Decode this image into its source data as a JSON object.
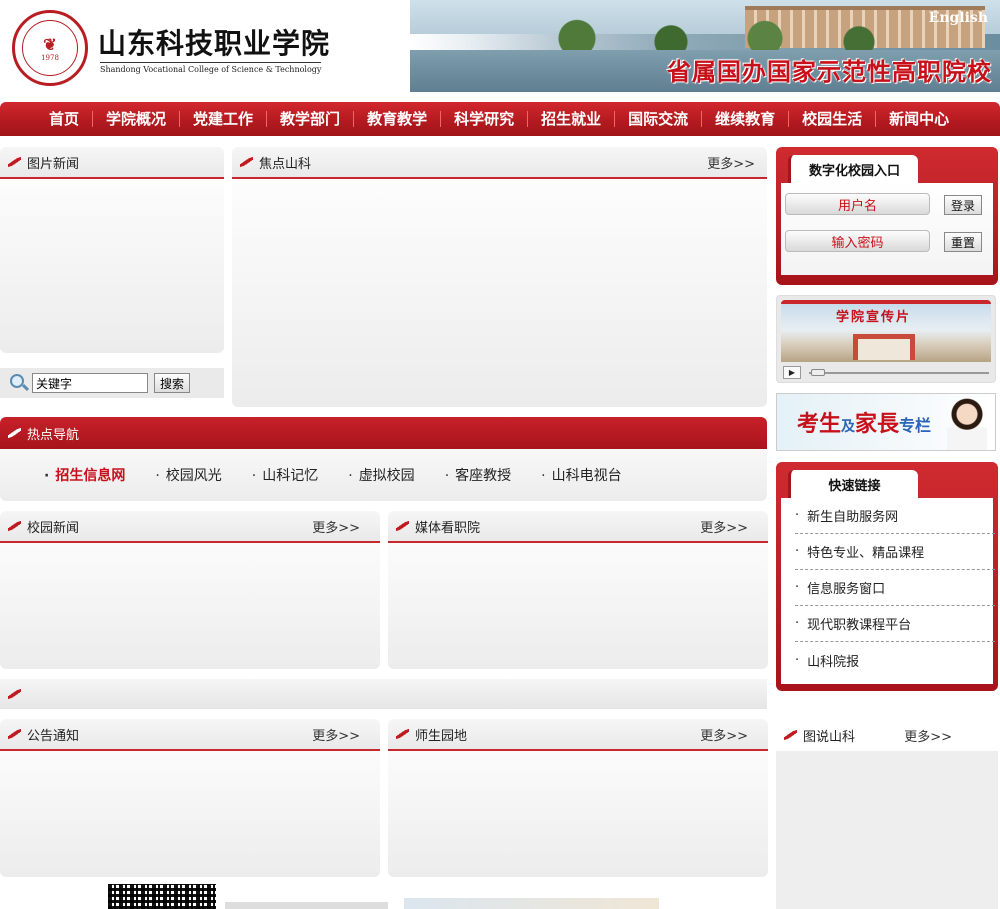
{
  "header": {
    "logo_year": "1978",
    "logo_cn": "山东科技职业学院",
    "logo_en": "Shandong Vocational College of Science & Technology",
    "english_link": "English",
    "slogan": "省属国办国家示范性高职院校"
  },
  "nav": [
    "首页",
    "学院概况",
    "党建工作",
    "教学部门",
    "教育教学",
    "科学研究",
    "招生就业",
    "国际交流",
    "继续教育",
    "校园生活",
    "新闻中心"
  ],
  "panels": {
    "photo_news": {
      "title": "图片新闻"
    },
    "focus": {
      "title": "焦点山科",
      "more": "更多>>"
    },
    "hot_nav": {
      "title": "热点导航",
      "items": [
        "招生信息网",
        "校园风光",
        "山科记忆",
        "虚拟校园",
        "客座教授",
        "山科电视台"
      ]
    },
    "campus_news": {
      "title": "校园新闻",
      "more": "更多>>"
    },
    "media": {
      "title": "媒体看职院",
      "more": "更多>>"
    },
    "notice": {
      "title": "公告通知",
      "more": "更多>>"
    },
    "teacher_student": {
      "title": "师生园地",
      "more": "更多>>"
    }
  },
  "search": {
    "placeholder": "关键字",
    "button": "搜索"
  },
  "login": {
    "title": "数字化校园入口",
    "username": "用户名",
    "password": "输入密码",
    "login_btn": "登录",
    "reset_btn": "重置"
  },
  "promo_video": {
    "title": "学院宣传片"
  },
  "exam_banner": {
    "text_a": "考生",
    "text_b": "及",
    "text_c": "家長",
    "text_d": "专栏"
  },
  "quick_links": {
    "title": "快速链接",
    "items": [
      "新生自助服务网",
      "特色专业、精品课程",
      "信息服务窗口",
      "现代职教课程平台",
      "山科院报"
    ]
  },
  "picture_story": {
    "title": "图说山科",
    "more": "更多>>"
  },
  "colors": {
    "brand_red": "#b41b20",
    "link_red": "#c8101a"
  }
}
